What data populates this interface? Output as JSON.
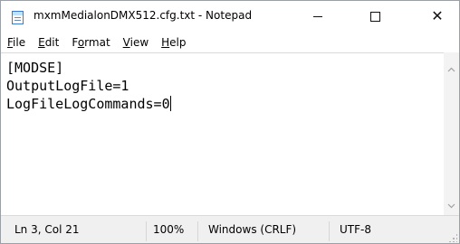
{
  "window": {
    "title": "mxmMedialonDMX512.cfg.txt - Notepad",
    "app_icon": "notepad-icon",
    "controls": {
      "minimize": "minimize-icon",
      "maximize": "maximize-icon",
      "close": "close-icon",
      "close_glyph": "✕"
    }
  },
  "menu": {
    "items": [
      {
        "pre": "",
        "key": "F",
        "post": "ile"
      },
      {
        "pre": "",
        "key": "E",
        "post": "dit"
      },
      {
        "pre": "F",
        "key": "o",
        "post": "rmat"
      },
      {
        "pre": "",
        "key": "V",
        "post": "iew"
      },
      {
        "pre": "",
        "key": "H",
        "post": "elp"
      }
    ]
  },
  "editor": {
    "lines": [
      "[MODSE]",
      "OutputLogFile=1",
      "LogFileLogCommands=0"
    ]
  },
  "scrollbar": {
    "up_arrow": "^",
    "down_arrow": "v"
  },
  "status": {
    "position": "Ln 3, Col 21",
    "zoom": "100%",
    "line_endings": "Windows (CRLF)",
    "encoding": "UTF-8"
  }
}
